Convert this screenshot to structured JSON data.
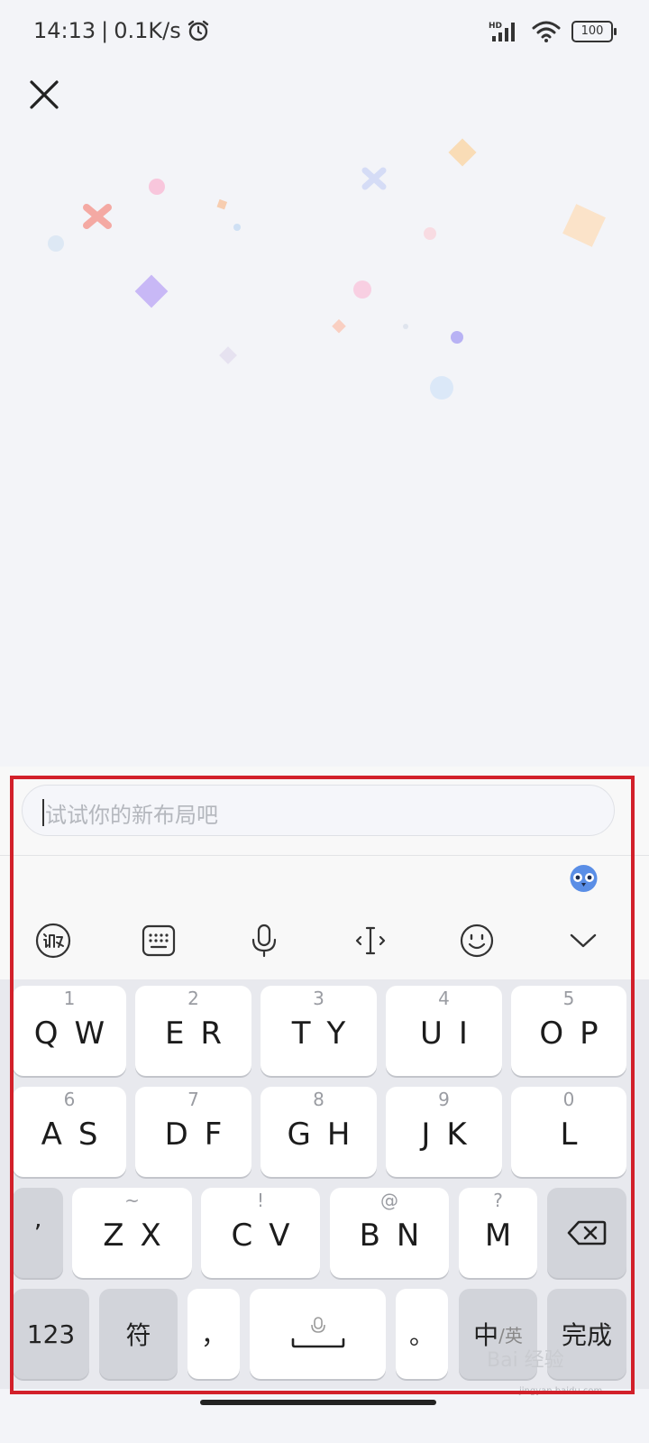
{
  "status_bar": {
    "time": "14:13",
    "separator": "|",
    "network_speed": "0.1K/s",
    "alarm_icon": "alarm-clock-icon",
    "signal_label": "HD",
    "battery": "100"
  },
  "close_icon": "close-icon",
  "input": {
    "placeholder": "试试你的新布局吧"
  },
  "toolbar": {
    "icons": [
      "ifly-logo-icon",
      "keyboard-icon",
      "microphone-icon",
      "text-cursor-icon",
      "emoji-icon",
      "chevron-down-icon"
    ]
  },
  "keyboard": {
    "row1": [
      {
        "hint": "1",
        "label": "QW"
      },
      {
        "hint": "2",
        "label": "ER"
      },
      {
        "hint": "3",
        "label": "TY"
      },
      {
        "hint": "4",
        "label": "UI"
      },
      {
        "hint": "5",
        "label": "OP"
      }
    ],
    "row2": [
      {
        "hint": "6",
        "label": "AS"
      },
      {
        "hint": "7",
        "label": "DF"
      },
      {
        "hint": "8",
        "label": "GH"
      },
      {
        "hint": "9",
        "label": "JK"
      },
      {
        "hint": "0",
        "label": "L"
      }
    ],
    "row3": {
      "apostrophe": "’",
      "keys": [
        {
          "hint": "~",
          "label": "ZX"
        },
        {
          "hint": "!",
          "label": "CV"
        },
        {
          "hint": "@",
          "label": "BN"
        },
        {
          "hint": "?",
          "label": "M"
        }
      ]
    },
    "row4": {
      "numbers": "123",
      "symbols": "符",
      "comma": "，",
      "period": "。",
      "lang_main": "中",
      "lang_alt": "/英",
      "done": "完成"
    }
  },
  "watermark": {
    "text": "Bai 经验",
    "url": "jingyan.baidu.com"
  },
  "colors": {
    "background": "#f3f4f8",
    "highlight_border": "#d2202a",
    "key": "#ffffff",
    "key_dark": "#d2d4da"
  }
}
